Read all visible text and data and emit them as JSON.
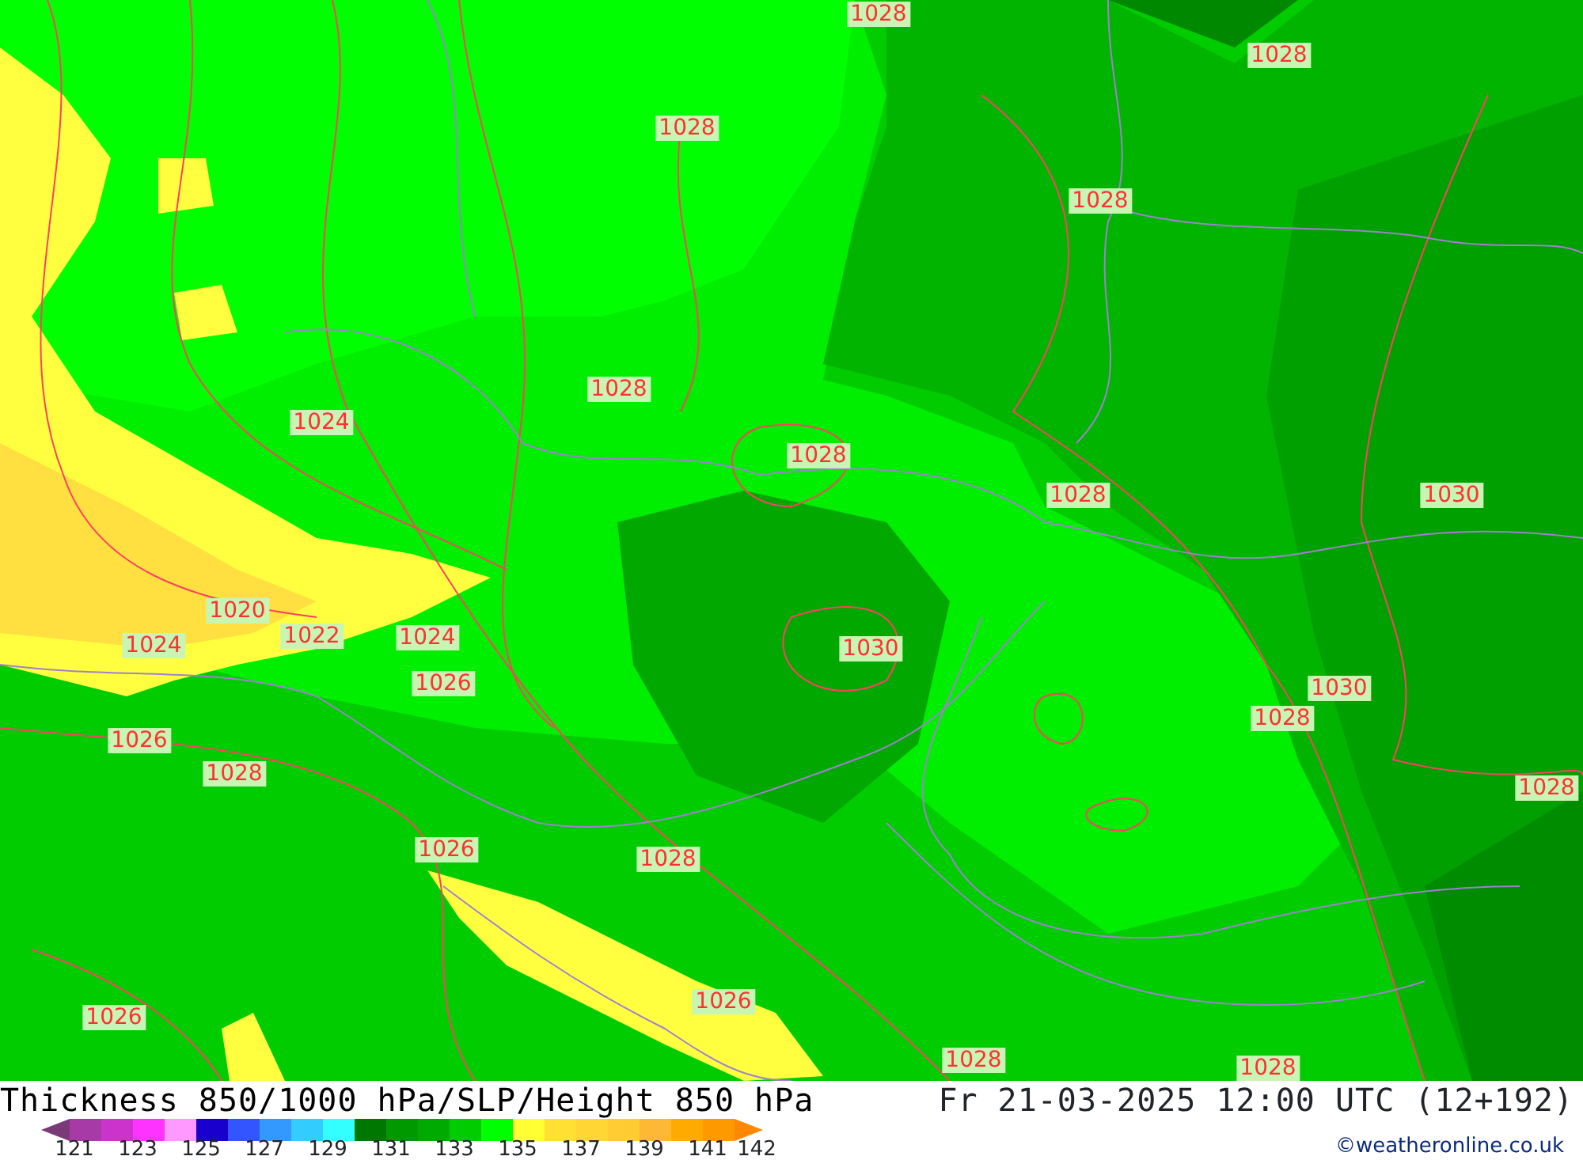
{
  "map": {
    "pressure_labels": [
      {
        "text": "1028"
      },
      {
        "text": "1028"
      },
      {
        "text": "1028"
      },
      {
        "text": "1028"
      },
      {
        "text": "1028"
      },
      {
        "text": "1024"
      },
      {
        "text": "1028"
      },
      {
        "text": "1028"
      },
      {
        "text": "1030"
      },
      {
        "text": "1020"
      },
      {
        "text": "1024"
      },
      {
        "text": "1022"
      },
      {
        "text": "1024"
      },
      {
        "text": "1030"
      },
      {
        "text": "1026"
      },
      {
        "text": "1030"
      },
      {
        "text": "1028"
      },
      {
        "text": "1026"
      },
      {
        "text": "1028"
      },
      {
        "text": "1028"
      },
      {
        "text": "1026"
      },
      {
        "text": "1028"
      },
      {
        "text": "1026"
      },
      {
        "text": "1026"
      },
      {
        "text": "1028"
      },
      {
        "text": "1028"
      }
    ]
  },
  "title": "Thickness 850/1000 hPa/SLP/Height 850 hPa",
  "valid_time": "Fr 21-03-2025 12:00 UTC (12+192)",
  "legend": {
    "swatches": [
      {
        "kind": "arrow",
        "color": "#7a3a7a"
      },
      {
        "kind": "bin",
        "color": "#a83aa8"
      },
      {
        "kind": "bin",
        "color": "#cc33cc"
      },
      {
        "kind": "bin",
        "color": "#ff33ff"
      },
      {
        "kind": "bin",
        "color": "#ff99ff"
      },
      {
        "kind": "bin",
        "color": "#1a00cc"
      },
      {
        "kind": "bin",
        "color": "#3355ff"
      },
      {
        "kind": "bin",
        "color": "#3399ff"
      },
      {
        "kind": "bin",
        "color": "#33ccff"
      },
      {
        "kind": "bin",
        "color": "#33ffff"
      },
      {
        "kind": "bin",
        "color": "#007700"
      },
      {
        "kind": "bin",
        "color": "#009900"
      },
      {
        "kind": "bin",
        "color": "#00aa00"
      },
      {
        "kind": "bin",
        "color": "#00cc00"
      },
      {
        "kind": "bin",
        "color": "#00ff00"
      },
      {
        "kind": "bin",
        "color": "#ffff33"
      },
      {
        "kind": "bin",
        "color": "#ffe033"
      },
      {
        "kind": "bin",
        "color": "#ffd633"
      },
      {
        "kind": "bin",
        "color": "#ffcc33"
      },
      {
        "kind": "bin",
        "color": "#ffb833"
      },
      {
        "kind": "bin",
        "color": "#ffaa00"
      },
      {
        "kind": "bin",
        "color": "#ff9900"
      },
      {
        "kind": "arrow",
        "color": "#ff8800"
      }
    ],
    "ticks": [
      "121",
      "123",
      "125",
      "127",
      "129",
      "131",
      "133",
      "135",
      "137",
      "139",
      "141",
      "142"
    ]
  },
  "credit": "©weatheronline.co.uk"
}
